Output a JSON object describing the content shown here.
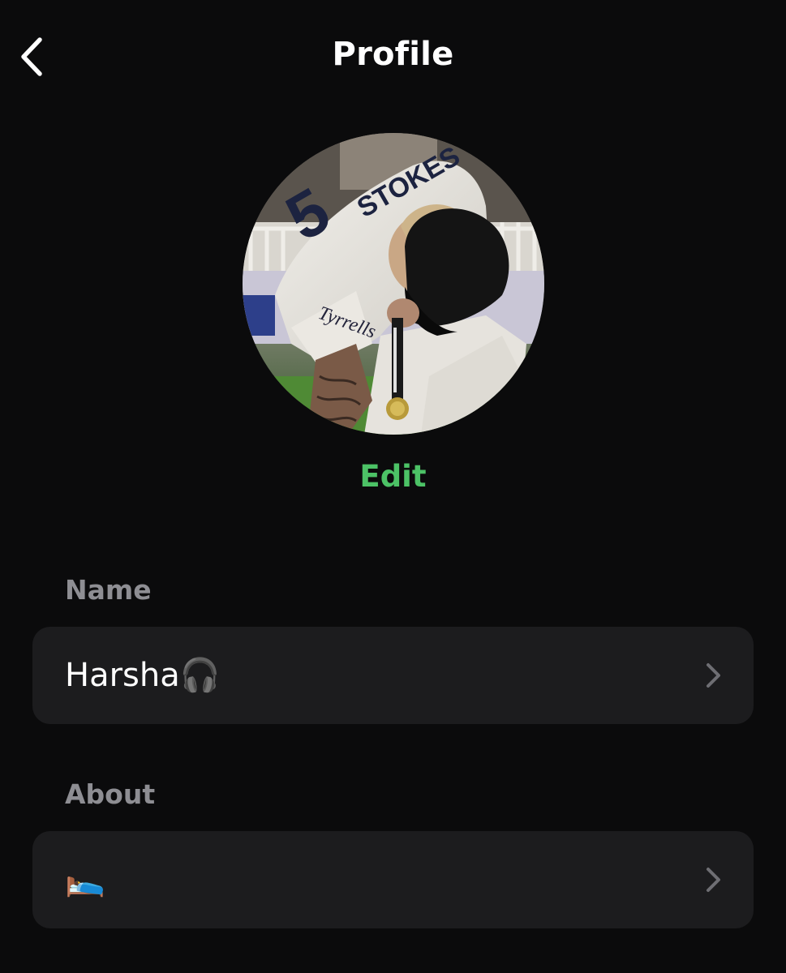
{
  "header": {
    "title": "Profile",
    "back_icon": "chevron-left-icon"
  },
  "profile_photo": {
    "edit_label": "Edit",
    "accent_color": "#4cc266"
  },
  "fields": {
    "name": {
      "label": "Name",
      "value": "Harsha🎧",
      "chevron_icon": "chevron-right-icon"
    },
    "about": {
      "label": "About",
      "value": "🛌",
      "chevron_icon": "chevron-right-icon"
    }
  },
  "colors": {
    "background": "#0b0b0c",
    "row_background": "#1c1c1e",
    "label": "#8e8e93",
    "accent": "#4cc266"
  }
}
